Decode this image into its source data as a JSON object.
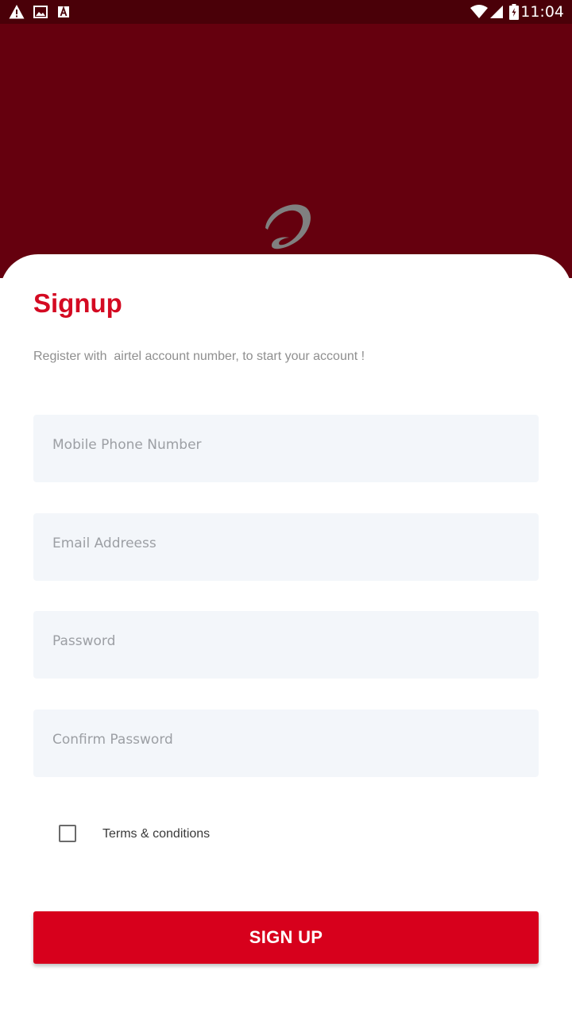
{
  "status_bar": {
    "time": "11:04",
    "left_icons": [
      "warning-icon",
      "image-icon",
      "font-icon"
    ],
    "right_icons": [
      "wifi-icon",
      "signal-icon",
      "battery-icon"
    ]
  },
  "header": {
    "logo": "airtel-logo",
    "background_color": "#65000e"
  },
  "form": {
    "title": "Signup",
    "subtitle": "Register with  airtel account number, to start your account !",
    "fields": [
      {
        "placeholder": "Mobile Phone Number",
        "value": ""
      },
      {
        "placeholder": "Email Addreess",
        "value": ""
      },
      {
        "placeholder": "Password",
        "value": ""
      },
      {
        "placeholder": "Confirm Password",
        "value": ""
      }
    ],
    "terms": {
      "label": "Terms & conditions",
      "checked": false
    },
    "submit_label": "SIGN UP"
  },
  "colors": {
    "accent": "#d7001c",
    "status_bar": "#4a0008"
  }
}
